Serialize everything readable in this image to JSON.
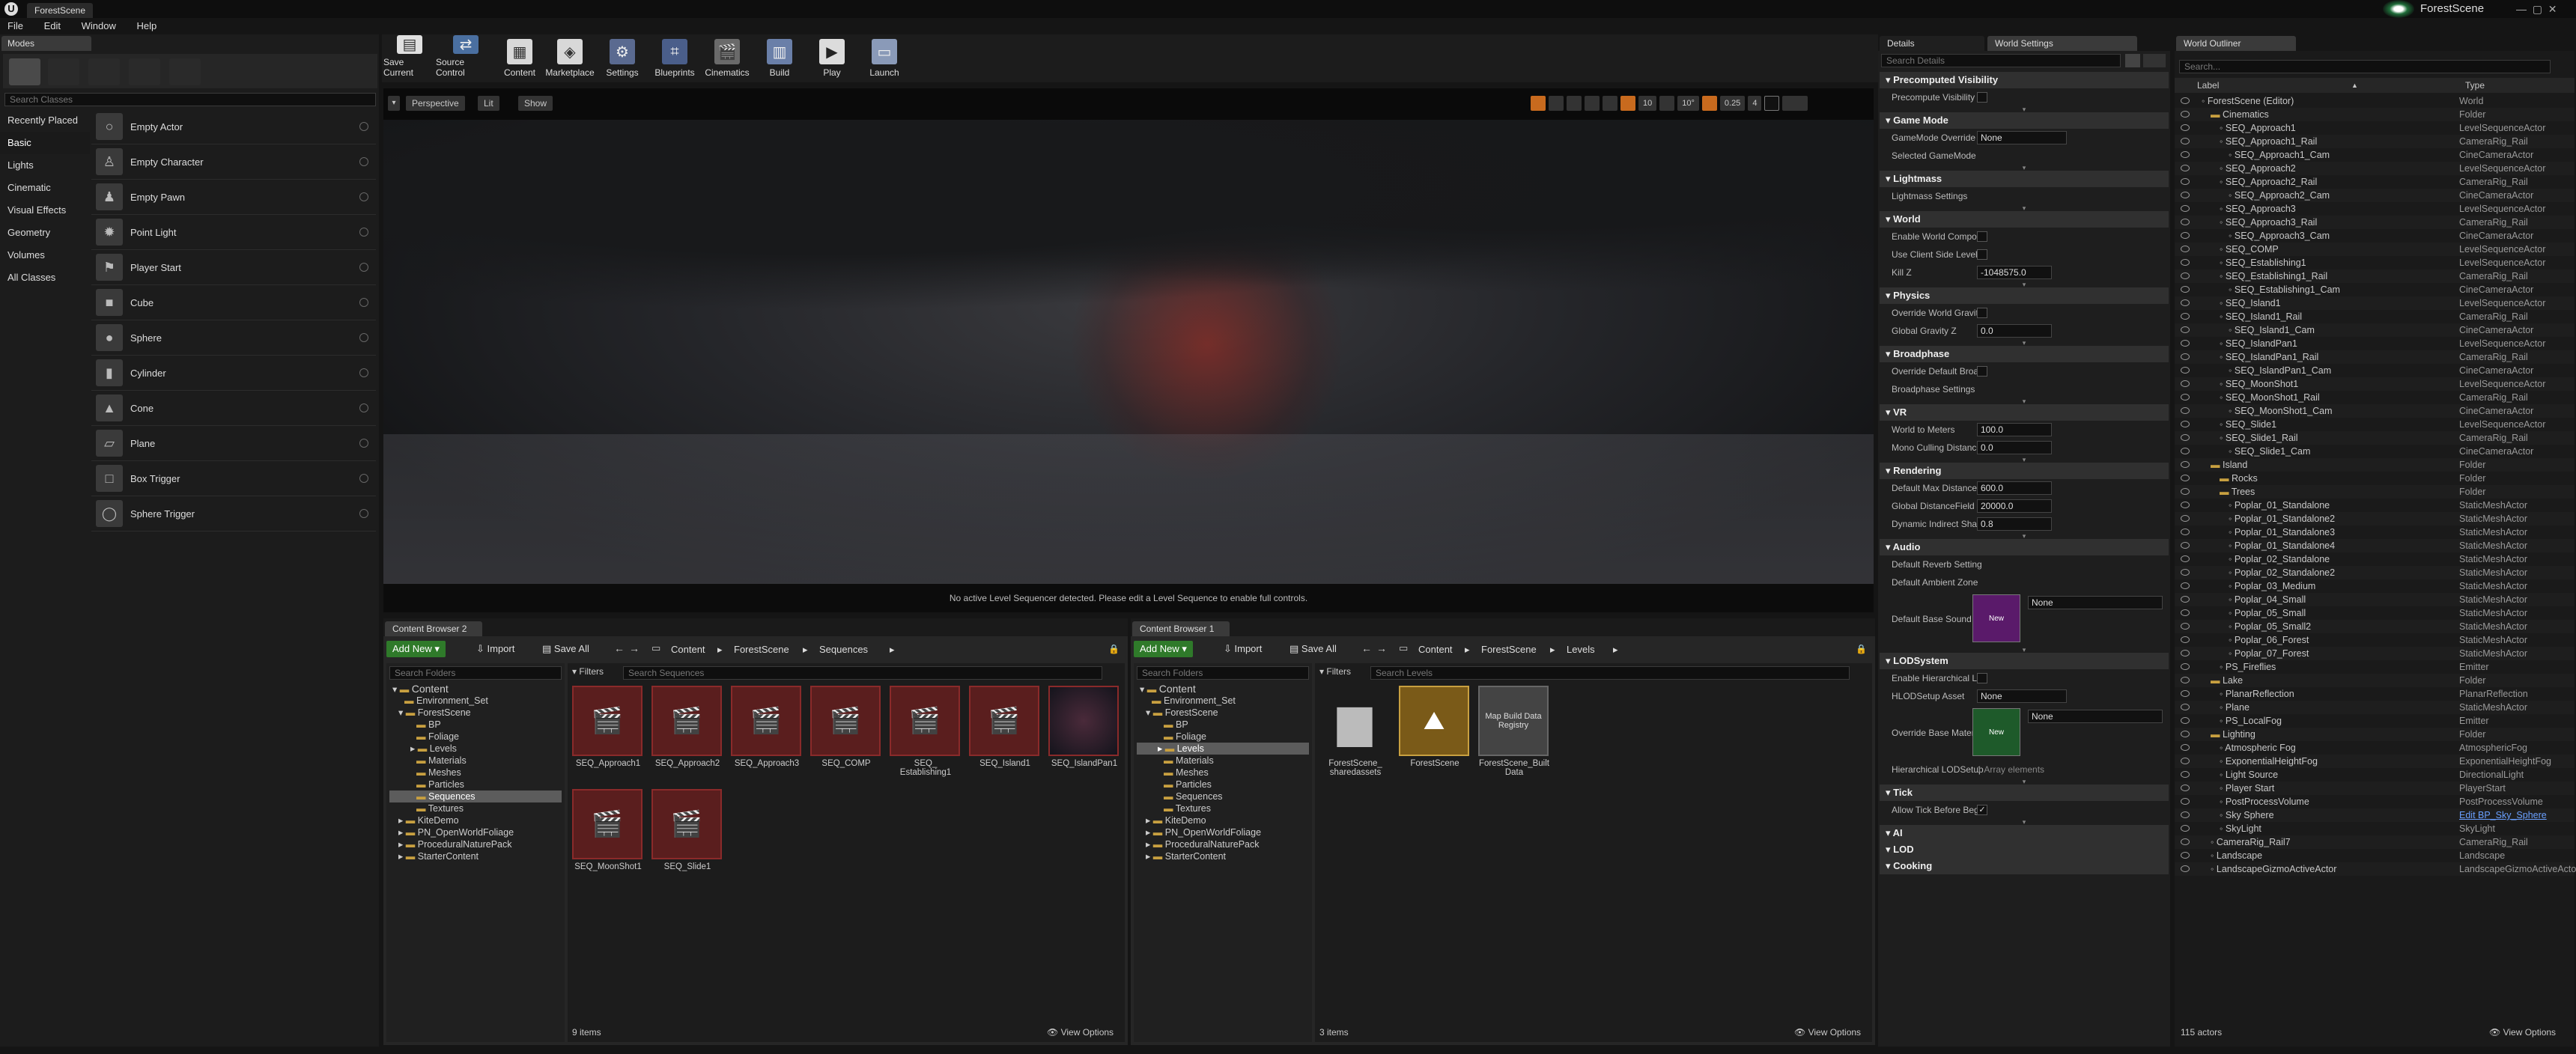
{
  "window": {
    "title": "ForestScene",
    "project": "ForestScene"
  },
  "menu": [
    "File",
    "Edit",
    "Window",
    "Help"
  ],
  "modes": {
    "tab": "Modes",
    "search_placeholder": "Search Classes",
    "categories": [
      "Recently Placed",
      "Basic",
      "Lights",
      "Cinematic",
      "Visual Effects",
      "Geometry",
      "Volumes",
      "All Classes"
    ],
    "selected_category": "Basic",
    "items": [
      "Empty Actor",
      "Empty Character",
      "Empty Pawn",
      "Point Light",
      "Player Start",
      "Cube",
      "Sphere",
      "Cylinder",
      "Cone",
      "Plane",
      "Box Trigger",
      "Sphere Trigger"
    ]
  },
  "toolbar": {
    "buttons": [
      {
        "label": "Save Current",
        "icon": "save-icon"
      },
      {
        "label": "Source Control",
        "icon": "source-control-icon"
      },
      {
        "label": "Content",
        "icon": "content-icon"
      },
      {
        "label": "Marketplace",
        "icon": "marketplace-icon"
      },
      {
        "label": "Settings",
        "icon": "settings-icon"
      },
      {
        "label": "Blueprints",
        "icon": "blueprints-icon"
      },
      {
        "label": "Cinematics",
        "icon": "cinematics-icon"
      },
      {
        "label": "Build",
        "icon": "build-icon"
      },
      {
        "label": "Play",
        "icon": "play-icon"
      },
      {
        "label": "Launch",
        "icon": "launch-icon"
      }
    ]
  },
  "viewport": {
    "perspective": "Perspective",
    "lit": "Lit",
    "show": "Show",
    "grid": "10",
    "angle": "10°",
    "scale": "0.25",
    "cam_speed": "4",
    "message": "No active Level Sequencer detected. Please edit a Level Sequence to enable full controls."
  },
  "content_browser_2": {
    "tab": "Content Browser 2",
    "add_new": "Add New",
    "import": "Import",
    "save_all": "Save All",
    "breadcrumb": [
      "Content",
      "ForestScene",
      "Sequences"
    ],
    "search_folders": "Search Folders",
    "filters": "Filters",
    "search_assets": "Search Sequences",
    "tree": [
      "Content",
      "Environment_Set",
      "ForestScene",
      "BP",
      "Foliage",
      "Levels",
      "Materials",
      "Meshes",
      "Particles",
      "Sequences",
      "Textures",
      "KiteDemo",
      "PN_OpenWorldFoliage",
      "ProceduralNaturePack",
      "StarterContent"
    ],
    "selected": "Sequences",
    "assets": [
      "SEQ_Approach1",
      "SEQ_Approach2",
      "SEQ_Approach3",
      "SEQ_COMP",
      "SEQ_\nEstablishing1",
      "SEQ_Island1",
      "SEQ_IslandPan1",
      "SEQ_MoonShot1",
      "SEQ_Slide1"
    ],
    "count": "9 items",
    "view_options": "View Options"
  },
  "content_browser_1": {
    "tab": "Content Browser 1",
    "add_new": "Add New",
    "import": "Import",
    "save_all": "Save All",
    "breadcrumb": [
      "Content",
      "ForestScene",
      "Levels"
    ],
    "search_folders": "Search Folders",
    "filters": "Filters",
    "search_assets": "Search Levels",
    "tree": [
      "Content",
      "Environment_Set",
      "ForestScene",
      "BP",
      "Foliage",
      "Levels",
      "Materials",
      "Meshes",
      "Particles",
      "Sequences",
      "Textures",
      "KiteDemo",
      "PN_OpenWorldFoliage",
      "ProceduralNaturePack",
      "StarterContent"
    ],
    "selected": "Levels",
    "assets": [
      "ForestScene_\nsharedassets",
      "ForestScene",
      "ForestScene_Built\nData"
    ],
    "map_build_label": "Map Build Data\nRegistry",
    "count": "3 items",
    "view_options": "View Options"
  },
  "details": {
    "tabs": [
      "Details",
      "World Settings"
    ],
    "search_placeholder": "Search Details",
    "sections": [
      {
        "title": "Precomputed Visibility",
        "rows": [
          {
            "label": "Precompute Visibility",
            "type": "check"
          }
        ]
      },
      {
        "title": "Game Mode",
        "rows": [
          {
            "label": "GameMode Override",
            "type": "select",
            "value": "None"
          },
          {
            "label": "Selected GameMode",
            "type": "text"
          }
        ]
      },
      {
        "title": "Lightmass",
        "rows": [
          {
            "label": "Lightmass Settings",
            "type": "text"
          }
        ]
      },
      {
        "title": "World",
        "rows": [
          {
            "label": "Enable World Composi",
            "type": "check"
          },
          {
            "label": "Use Client Side Level",
            "type": "check"
          },
          {
            "label": "Kill Z",
            "type": "num",
            "value": "-1048575.0"
          }
        ]
      },
      {
        "title": "Physics",
        "rows": [
          {
            "label": "Override World Gravity",
            "type": "check"
          },
          {
            "label": "Global Gravity Z",
            "type": "num",
            "value": "0.0"
          }
        ]
      },
      {
        "title": "Broadphase",
        "rows": [
          {
            "label": "Override Default Broa",
            "type": "check"
          },
          {
            "label": "Broadphase Settings",
            "type": "text"
          }
        ]
      },
      {
        "title": "VR",
        "rows": [
          {
            "label": "World to Meters",
            "type": "num",
            "value": "100.0"
          },
          {
            "label": "Mono Culling Distance",
            "type": "num",
            "value": "0.0"
          }
        ]
      },
      {
        "title": "Rendering",
        "rows": [
          {
            "label": "Default Max Distance",
            "type": "num",
            "value": "600.0"
          },
          {
            "label": "Global DistanceField V",
            "type": "num",
            "value": "20000.0"
          },
          {
            "label": "Dynamic Indirect Shad",
            "type": "num",
            "value": "0.8"
          }
        ]
      },
      {
        "title": "Audio",
        "rows": [
          {
            "label": "Default Reverb Setting",
            "type": "text"
          },
          {
            "label": "Default Ambient Zone",
            "type": "text"
          },
          {
            "label": "Default Base Sound M",
            "type": "asset",
            "value": "None",
            "thumb": "New"
          }
        ]
      },
      {
        "title": "LODSystem",
        "rows": [
          {
            "label": "Enable Hierarchical LC",
            "type": "check"
          },
          {
            "label": "HLODSetup Asset",
            "type": "select",
            "value": "None"
          },
          {
            "label": "Override Base Materia",
            "type": "asset",
            "value": "None",
            "thumb": "New"
          },
          {
            "label": "Hierarchical LODSetup",
            "type": "note",
            "value": "1 Array elements"
          }
        ]
      },
      {
        "title": "Tick",
        "rows": [
          {
            "label": "Allow Tick Before Beg",
            "type": "checked"
          }
        ]
      },
      {
        "title": "AI",
        "rows": []
      },
      {
        "title": "LOD",
        "rows": []
      },
      {
        "title": "Cooking",
        "rows": []
      }
    ]
  },
  "outliner": {
    "tab": "World Outliner",
    "search_placeholder": "Search...",
    "col_label": "Label",
    "col_type": "Type",
    "rows": [
      {
        "n": "ForestScene (Editor)",
        "t": "World",
        "d": 0
      },
      {
        "n": "Cinematics",
        "t": "Folder",
        "d": 1
      },
      {
        "n": "SEQ_Approach1",
        "t": "LevelSequenceActor",
        "d": 2
      },
      {
        "n": "SEQ_Approach1_Rail",
        "t": "CameraRig_Rail",
        "d": 2
      },
      {
        "n": "SEQ_Approach1_Cam",
        "t": "CineCameraActor",
        "d": 3
      },
      {
        "n": "SEQ_Approach2",
        "t": "LevelSequenceActor",
        "d": 2
      },
      {
        "n": "SEQ_Approach2_Rail",
        "t": "CameraRig_Rail",
        "d": 2
      },
      {
        "n": "SEQ_Approach2_Cam",
        "t": "CineCameraActor",
        "d": 3
      },
      {
        "n": "SEQ_Approach3",
        "t": "LevelSequenceActor",
        "d": 2
      },
      {
        "n": "SEQ_Approach3_Rail",
        "t": "CameraRig_Rail",
        "d": 2
      },
      {
        "n": "SEQ_Approach3_Cam",
        "t": "CineCameraActor",
        "d": 3
      },
      {
        "n": "SEQ_COMP",
        "t": "LevelSequenceActor",
        "d": 2
      },
      {
        "n": "SEQ_Establishing1",
        "t": "LevelSequenceActor",
        "d": 2
      },
      {
        "n": "SEQ_Establishing1_Rail",
        "t": "CameraRig_Rail",
        "d": 2
      },
      {
        "n": "SEQ_Establishing1_Cam",
        "t": "CineCameraActor",
        "d": 3
      },
      {
        "n": "SEQ_Island1",
        "t": "LevelSequenceActor",
        "d": 2
      },
      {
        "n": "SEQ_Island1_Rail",
        "t": "CameraRig_Rail",
        "d": 2
      },
      {
        "n": "SEQ_Island1_Cam",
        "t": "CineCameraActor",
        "d": 3
      },
      {
        "n": "SEQ_IslandPan1",
        "t": "LevelSequenceActor",
        "d": 2
      },
      {
        "n": "SEQ_IslandPan1_Rail",
        "t": "CameraRig_Rail",
        "d": 2
      },
      {
        "n": "SEQ_IslandPan1_Cam",
        "t": "CineCameraActor",
        "d": 3
      },
      {
        "n": "SEQ_MoonShot1",
        "t": "LevelSequenceActor",
        "d": 2
      },
      {
        "n": "SEQ_MoonShot1_Rail",
        "t": "CameraRig_Rail",
        "d": 2
      },
      {
        "n": "SEQ_MoonShot1_Cam",
        "t": "CineCameraActor",
        "d": 3
      },
      {
        "n": "SEQ_Slide1",
        "t": "LevelSequenceActor",
        "d": 2
      },
      {
        "n": "SEQ_Slide1_Rail",
        "t": "CameraRig_Rail",
        "d": 2
      },
      {
        "n": "SEQ_Slide1_Cam",
        "t": "CineCameraActor",
        "d": 3
      },
      {
        "n": "Island",
        "t": "Folder",
        "d": 1
      },
      {
        "n": "Rocks",
        "t": "Folder",
        "d": 2
      },
      {
        "n": "Trees",
        "t": "Folder",
        "d": 2
      },
      {
        "n": "Poplar_01_Standalone",
        "t": "StaticMeshActor",
        "d": 3
      },
      {
        "n": "Poplar_01_Standalone2",
        "t": "StaticMeshActor",
        "d": 3
      },
      {
        "n": "Poplar_01_Standalone3",
        "t": "StaticMeshActor",
        "d": 3
      },
      {
        "n": "Poplar_01_Standalone4",
        "t": "StaticMeshActor",
        "d": 3
      },
      {
        "n": "Poplar_02_Standalone",
        "t": "StaticMeshActor",
        "d": 3
      },
      {
        "n": "Poplar_02_Standalone2",
        "t": "StaticMeshActor",
        "d": 3
      },
      {
        "n": "Poplar_03_Medium",
        "t": "StaticMeshActor",
        "d": 3
      },
      {
        "n": "Poplar_04_Small",
        "t": "StaticMeshActor",
        "d": 3
      },
      {
        "n": "Poplar_05_Small",
        "t": "StaticMeshActor",
        "d": 3
      },
      {
        "n": "Poplar_05_Small2",
        "t": "StaticMeshActor",
        "d": 3
      },
      {
        "n": "Poplar_06_Forest",
        "t": "StaticMeshActor",
        "d": 3
      },
      {
        "n": "Poplar_07_Forest",
        "t": "StaticMeshActor",
        "d": 3
      },
      {
        "n": "PS_Fireflies",
        "t": "Emitter",
        "d": 2
      },
      {
        "n": "Lake",
        "t": "Folder",
        "d": 1
      },
      {
        "n": "PlanarReflection",
        "t": "PlanarReflection",
        "d": 2
      },
      {
        "n": "Plane",
        "t": "StaticMeshActor",
        "d": 2
      },
      {
        "n": "PS_LocalFog",
        "t": "Emitter",
        "d": 2
      },
      {
        "n": "Lighting",
        "t": "Folder",
        "d": 1
      },
      {
        "n": "Atmospheric Fog",
        "t": "AtmosphericFog",
        "d": 2
      },
      {
        "n": "ExponentialHeightFog",
        "t": "ExponentialHeightFog",
        "d": 2
      },
      {
        "n": "Light Source",
        "t": "DirectionalLight",
        "d": 2
      },
      {
        "n": "Player Start",
        "t": "PlayerStart",
        "d": 2
      },
      {
        "n": "PostProcessVolume",
        "t": "PostProcessVolume",
        "d": 2
      },
      {
        "n": "Sky Sphere",
        "t": "Edit BP_Sky_Sphere",
        "d": 2,
        "link": true
      },
      {
        "n": "SkyLight",
        "t": "SkyLight",
        "d": 2
      },
      {
        "n": "CameraRig_Rail7",
        "t": "CameraRig_Rail",
        "d": 1
      },
      {
        "n": "Landscape",
        "t": "Landscape",
        "d": 1
      },
      {
        "n": "LandscapeGizmoActiveActor",
        "t": "LandscapeGizmoActiveActor",
        "d": 1
      }
    ],
    "count": "115 actors",
    "view_options": "View Options"
  },
  "colors": {
    "accent": "#2f7a2a",
    "folder": "#c8a040",
    "sequence_bg": "#5a1e1e",
    "link": "#6aa0ff"
  }
}
